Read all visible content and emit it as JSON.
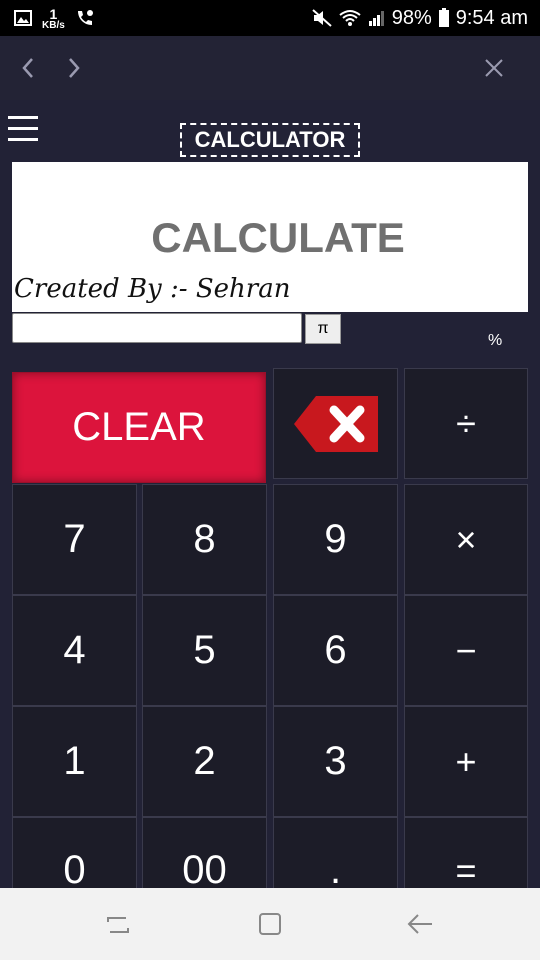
{
  "status": {
    "speed_num": "1",
    "speed_unit": "KB/s",
    "battery": "98%",
    "time": "9:54 am"
  },
  "nav": {
    "back_icon": "chevron-left",
    "forward_icon": "chevron-right",
    "close_icon": "close"
  },
  "header": {
    "menu_icon": "hamburger",
    "title": "CALCULATOR"
  },
  "banner": {
    "heading": "CALCULATE",
    "credit": "Created By :- Sehran"
  },
  "display": {
    "value": "",
    "pi_label": "π",
    "percent_label": "%"
  },
  "keys": {
    "clear": "CLEAR",
    "divide": "÷",
    "multiply": "×",
    "minus": "−",
    "plus": "+",
    "equals": "=",
    "seven": "7",
    "eight": "8",
    "nine": "9",
    "four": "4",
    "five": "5",
    "six": "6",
    "one": "1",
    "two": "2",
    "three": "3",
    "zero": "0",
    "double_zero": "00",
    "dot": "."
  },
  "colors": {
    "clear_bg": "#dc143c",
    "backspace": "#c8181e",
    "app_bg": "#222236",
    "key_bg": "#1c1c28"
  }
}
